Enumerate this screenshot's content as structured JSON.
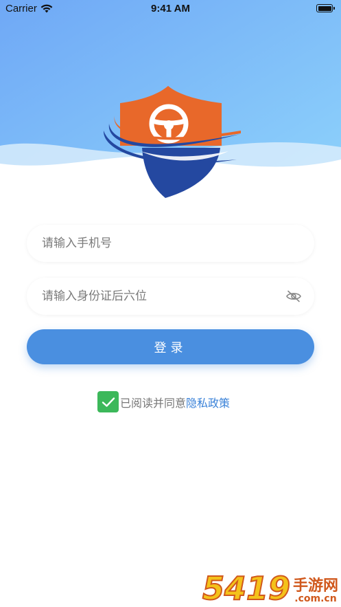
{
  "status_bar": {
    "carrier": "Carrier",
    "time": "9:41 AM",
    "wifi_icon": "wifi-icon",
    "battery_icon": "battery-full-icon"
  },
  "logo": {
    "icon": "shield-steering-wheel-logo",
    "colors": {
      "shield_top": "#e8682a",
      "shield_bottom": "#2448a0",
      "swoosh": "#2448a0",
      "swoosh_accent": "#e8682a"
    }
  },
  "form": {
    "phone_placeholder": "请输入手机号",
    "phone_value": "",
    "id_placeholder": "请输入身份证后六位",
    "id_value": "",
    "visibility_icon": "eye-off-icon"
  },
  "login_button_label": "登录",
  "agreement": {
    "checked": true,
    "checkbox_icon": "checkmark-icon",
    "prefix": "已阅读并同意",
    "link": "隐私政策"
  },
  "watermark": {
    "number": "5419",
    "brand": "手游网",
    "domain": ".com.cn"
  },
  "colors": {
    "hero_gradient_start": "#6fa8f6",
    "hero_gradient_end": "#8fd4fb",
    "primary_button": "#4a8fe0",
    "link": "#3a82d8",
    "checkbox": "#3cb85a"
  }
}
